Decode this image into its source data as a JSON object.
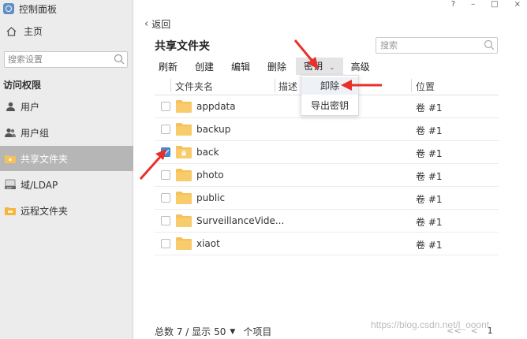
{
  "window": {
    "title": "控制面板",
    "controls": [
      "?",
      "–",
      "□",
      "×"
    ]
  },
  "sidebar": {
    "home_label": "主页",
    "search_placeholder": "搜索设置",
    "section_label": "访问权限",
    "items": [
      {
        "label": "用户",
        "icon": "user-icon"
      },
      {
        "label": "用户组",
        "icon": "group-icon"
      },
      {
        "label": "共享文件夹",
        "icon": "shared-folder-icon",
        "active": true
      },
      {
        "label": "域/LDAP",
        "icon": "ldap-icon"
      },
      {
        "label": "远程文件夹",
        "icon": "remote-folder-icon"
      }
    ]
  },
  "main": {
    "back_label": "返回",
    "title": "共享文件夹",
    "search_placeholder": "搜索",
    "toolbar": {
      "refresh": "刷新",
      "create": "创建",
      "edit": "编辑",
      "delete": "删除",
      "key": "密钥",
      "advanced": "高级"
    },
    "key_menu": [
      "卸除",
      "导出密钥"
    ],
    "columns": {
      "name": "文件夹名",
      "desc": "描述",
      "location": "位置"
    },
    "rows": [
      {
        "name": "appdata",
        "location": "卷 #1",
        "checked": false,
        "locked": false
      },
      {
        "name": "backup",
        "location": "卷 #1",
        "checked": false,
        "locked": false
      },
      {
        "name": "back",
        "location": "卷 #1",
        "checked": true,
        "locked": true
      },
      {
        "name": "photo",
        "location": "卷 #1",
        "checked": false,
        "locked": false
      },
      {
        "name": "public",
        "location": "卷 #1",
        "checked": false,
        "locked": false
      },
      {
        "name": "SurveillanceVide...",
        "location": "卷 #1",
        "checked": false,
        "locked": false
      },
      {
        "name": "xiaot",
        "location": "卷 #1",
        "checked": false,
        "locked": false
      }
    ]
  },
  "footer": {
    "total_prefix": "总数 7 / 显示",
    "page_size": "50",
    "suffix": "个项目",
    "pager": {
      "first": "<<",
      "prev": "<",
      "page": "1"
    }
  },
  "watermark": "https://blog.csdn.net/l_ooont",
  "colors": {
    "folder": "#f5c15a",
    "accent": "#4a8bd1",
    "arrow": "#e8302a"
  }
}
